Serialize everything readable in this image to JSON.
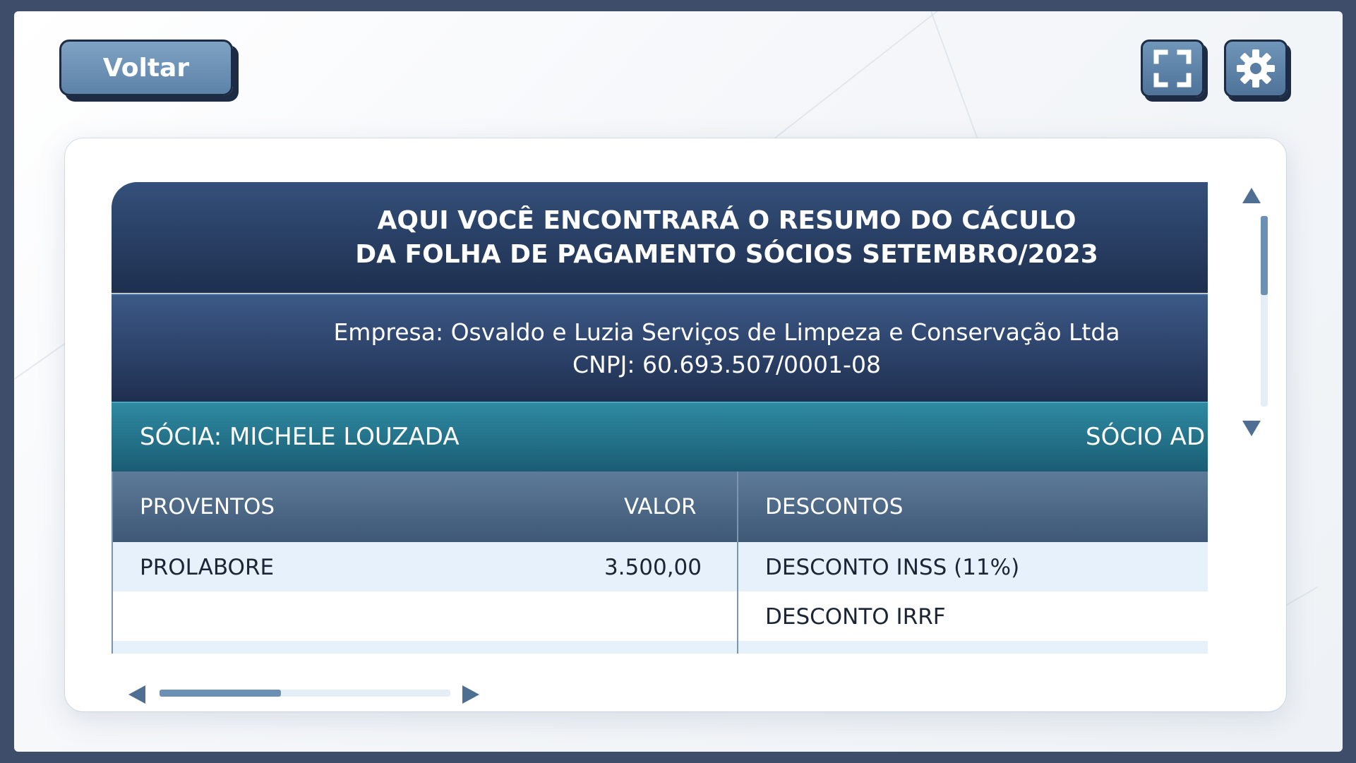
{
  "toolbar": {
    "back_label": "Voltar",
    "fullscreen_icon": "fullscreen-icon",
    "settings_icon": "gear-icon"
  },
  "header": {
    "title_line1": "AQUI VOCÊ ENCONTRARÁ O RESUMO DO CÁCULO",
    "title_line2": "DA FOLHA DE PAGAMENTO SÓCIOS SETEMBRO/2023"
  },
  "company": {
    "name": "Empresa: Osvaldo e Luzia Serviços de Limpeza e Conservação Ltda",
    "cnpj": "CNPJ: 60.693.507/0001-08"
  },
  "partners": {
    "first": "SÓCIA: MICHELE LOUZADA",
    "second": "SÓCIO AD"
  },
  "table": {
    "headers": {
      "proventos": "PROVENTOS",
      "valor": "VALOR",
      "descontos": "DESCONTOS"
    },
    "rows": [
      {
        "provento": "PROLABORE",
        "valor": "3.500,00",
        "desconto": "DESCONTO INSS (11%)"
      },
      {
        "provento": "",
        "valor": "",
        "desconto": "DESCONTO IRRF"
      }
    ]
  },
  "scrollbars": {
    "vertical_position": 0.41,
    "horizontal_position": 0.42
  },
  "colors": {
    "frame": "#3e4d69",
    "title_band": "#1e2f4f",
    "partner_band": "#1a5d74",
    "accent": "#5d82a8"
  }
}
